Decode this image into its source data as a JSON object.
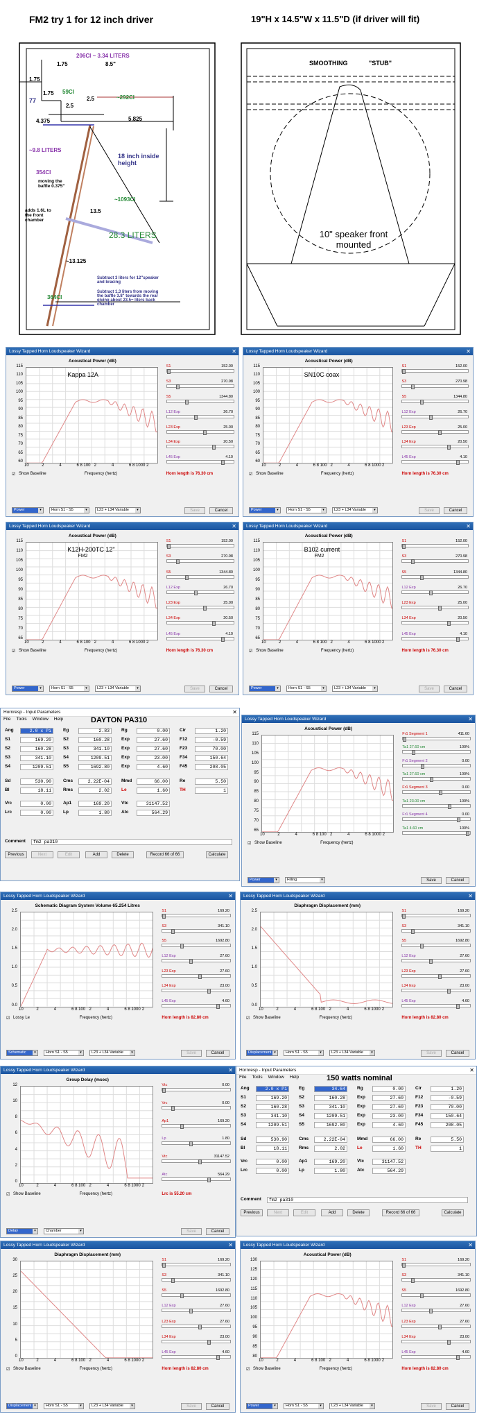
{
  "sketch": {
    "title_left": "FM2 try 1 for 12 inch driver",
    "title_right": "19\"H x 14.5\"W x 11.5\"D (if  driver will fit)",
    "dims": {
      "d175a": "1.75",
      "ci206": "206CI ~ 3.34 LITERS",
      "d85": "8.5\"",
      "d175b": "1.75",
      "ci59": "59CI",
      "ci292": "~292CI",
      "d175c": "1.75",
      "d25a": "2.5",
      "d77": "77",
      "d25b": "2.5",
      "d4375": "4.375",
      "d5825": "5.825",
      "l98": "~9.8 LITERS",
      "inch18": "18 inch inside height",
      "ci354": "354CI",
      "moving": "moving the baffle 0.375\"",
      "adds": "adds 1.6L to the front chamber",
      "ci1093": "~1093CI",
      "d135": "13.5",
      "l283": "28.3 LITERS",
      "d13125": "~13.125",
      "sub1": "Subtract 3 liters for 12\"speaker and bracing",
      "sub2": "Subtract 1.3 liters from moving the baffle 3.8\" towards the rear giving about 23.5~ liters back chamber",
      "ci364": "364CI"
    },
    "right": {
      "smoothing": "SMOOTHING",
      "stub": "\"STUB\"",
      "speaker": "10\" speaker front mounted"
    }
  },
  "wizard_title": "Lossy Tapped Horn Loudspeaker Wizard",
  "acoustical_title": "Acoustical Power (dB)",
  "freq_label": "Frequency (hertz)",
  "show_baseline": "Show Baseline",
  "save": "Save",
  "cancel": "Cancel",
  "power": "Power",
  "horn_s1s5": "Horn S1 - S5",
  "l23l34": "L23 + L34 Variable",
  "horn_length_7630": "Horn length is 76.30 cm",
  "horn_length_8280": "Horn length is 82.80 cm",
  "lrc": "Lrc is 55.20 cm",
  "yticks_power": [
    "115",
    "110",
    "105",
    "100",
    "95",
    "90",
    "85",
    "80",
    "75",
    "70",
    "65",
    "60"
  ],
  "yticks_power2": [
    "115",
    "110",
    "105",
    "100",
    "95",
    "90",
    "85",
    "80",
    "75",
    "70",
    "65"
  ],
  "xticks": [
    "10",
    "2",
    "4",
    "6 8 100",
    "2",
    "4",
    "6 8 1000",
    "2"
  ],
  "params_a": [
    {
      "label": "S1",
      "value": "152.00",
      "cls": "redtxt"
    },
    {
      "label": "S3",
      "value": "270.98",
      "cls": "redtxt"
    },
    {
      "label": "S5",
      "value": "1344.80",
      "cls": "redtxt"
    },
    {
      "label": "L12 Exp",
      "value": "26.70",
      "cls": "purple"
    },
    {
      "label": "L23 Exp",
      "value": "25.00",
      "cls": "redtxt"
    },
    {
      "label": "L34 Exp",
      "value": "20.50",
      "cls": "redtxt"
    },
    {
      "label": "L45 Exp",
      "value": "4.10",
      "cls": "purple"
    }
  ],
  "params_b": [
    {
      "label": "S1",
      "value": "169.20",
      "cls": "redtxt"
    },
    {
      "label": "S3",
      "value": "341.10",
      "cls": "redtxt"
    },
    {
      "label": "S5",
      "value": "1692.80",
      "cls": "redtxt"
    },
    {
      "label": "L12 Exp",
      "value": "27.60",
      "cls": "purple"
    },
    {
      "label": "L23 Exp",
      "value": "27.60",
      "cls": "redtxt"
    },
    {
      "label": "L34 Exp",
      "value": "23.00",
      "cls": "redtxt"
    },
    {
      "label": "L45 Exp",
      "value": "4.60",
      "cls": "purple"
    }
  ],
  "params_fr": [
    {
      "label": "Fr1 Segment 1",
      "value": "411.60",
      "cls": "redtxt"
    },
    {
      "label": "Ta1 27.60 cm",
      "value": "100%",
      "cls": "green"
    },
    {
      "label": "Fr1 Segment 2",
      "value": "0.00",
      "cls": "purple"
    },
    {
      "label": "Ta1 27.60 cm",
      "value": "100%",
      "cls": "green"
    },
    {
      "label": "Fr1 Segment 3",
      "value": "0.00",
      "cls": "redtxt"
    },
    {
      "label": "Ta1 23.00 cm",
      "value": "100%",
      "cls": "green"
    },
    {
      "label": "Fr1 Segment 4",
      "value": "0.00",
      "cls": "purple"
    },
    {
      "label": "Ta1 4.60 cm",
      "value": "100%",
      "cls": "green"
    }
  ],
  "params_gd": [
    {
      "label": "Vtc",
      "value": "0.00",
      "cls": "redtxt"
    },
    {
      "label": "Vrc",
      "value": "0.00",
      "cls": "redtxt"
    },
    {
      "label": "Ap1",
      "value": "169.20",
      "cls": "redtxt"
    },
    {
      "label": "Lp",
      "value": "1.80",
      "cls": "purple"
    },
    {
      "label": "Vtc",
      "value": "31147.52",
      "cls": "redtxt"
    },
    {
      "label": "Atc",
      "value": "564.29",
      "cls": "purple"
    }
  ],
  "panels": {
    "p1": {
      "label": "Kappa 12A"
    },
    "p2": {
      "label": "SN10C coax"
    },
    "p3": {
      "label": "K12H-200TC 12\"",
      "sub": "FM2"
    },
    "p4": {
      "label": "B102 current",
      "sub": "FM2"
    }
  },
  "hornresp": {
    "title": "Hornresp - Input Parameters",
    "menu": [
      "File",
      "Tools",
      "Window",
      "Help"
    ],
    "note1": "DAYTON  PA310",
    "note2": "150 watts nominal",
    "rows": [
      [
        [
          "Ang",
          "2.0 x Pi"
        ],
        [
          "Eg",
          "2.83"
        ],
        [
          "Rg",
          "0.00"
        ],
        [
          "Cir",
          "1.20"
        ]
      ],
      [
        [
          "S1",
          "169.20"
        ],
        [
          "S2",
          "160.28"
        ],
        [
          "Exp",
          "27.60"
        ],
        [
          "F12",
          "-0.59"
        ]
      ],
      [
        [
          "S2",
          "160.28"
        ],
        [
          "S3",
          "341.10"
        ],
        [
          "Exp",
          "27.60"
        ],
        [
          "F23",
          "70.00"
        ]
      ],
      [
        [
          "S3",
          "341.10"
        ],
        [
          "S4",
          "1209.51"
        ],
        [
          "Exp",
          "23.00"
        ],
        [
          "F34",
          "150.64"
        ]
      ],
      [
        [
          "S4",
          "1209.51"
        ],
        [
          "S5",
          "1692.80"
        ],
        [
          "Exp",
          "4.60"
        ],
        [
          "F45",
          "208.05"
        ]
      ],
      [
        [
          "Sd",
          "530.90"
        ],
        [
          "Cms",
          "2.22E-04"
        ],
        [
          "Mmd",
          "66.00"
        ],
        [
          "Re",
          "5.50"
        ]
      ],
      [
        [
          "Bl",
          "18.11"
        ],
        [
          "Rms",
          "2.02"
        ],
        [
          "Le",
          "1.60"
        ],
        [
          "TH",
          "1"
        ]
      ],
      [
        [
          "Vrc",
          "0.00"
        ],
        [
          "Ap1",
          "169.20"
        ],
        [
          "Vtc",
          "31147.52"
        ]
      ],
      [
        [
          "Lrc",
          "0.00"
        ],
        [
          "Lp",
          "1.80"
        ],
        [
          "Atc",
          "564.29"
        ]
      ]
    ],
    "eg2": "34.64",
    "comment_label": "Comment",
    "comment": "fm2 pa310",
    "buttons": [
      "Previous",
      "Next",
      "Edit",
      "Add",
      "Delete",
      "Record 66 of 66",
      "Calculate"
    ]
  },
  "schematic_title": "Schematic Diagram   System Volume 65.254 Litres",
  "lossy_le": "Lossy Le",
  "schematic": "Schematic",
  "diaphragm_title": "Diaphragm Displacement (mm)",
  "displacement": "Displacement",
  "group_delay_title": "Group Delay (msec)",
  "delay": "Delay",
  "chamber": "Chamber",
  "filling": "Filling",
  "ydisp1": [
    "2.5",
    "2.0",
    "1.5",
    "1.0",
    "0.5",
    "0.0"
  ],
  "ygd": [
    "12",
    "10",
    "8",
    "6",
    "4",
    "2",
    "0"
  ],
  "ydisp2": [
    "30",
    "25",
    "20",
    "15",
    "10",
    "5",
    "0"
  ],
  "ypow3": [
    "130",
    "125",
    "120",
    "115",
    "110",
    "105",
    "100",
    "95",
    "90",
    "85",
    "80"
  ],
  "ypow4": [
    "115",
    "110",
    "105",
    "100",
    "95",
    "90",
    "85",
    "80",
    "75",
    "70",
    "65",
    "60"
  ]
}
